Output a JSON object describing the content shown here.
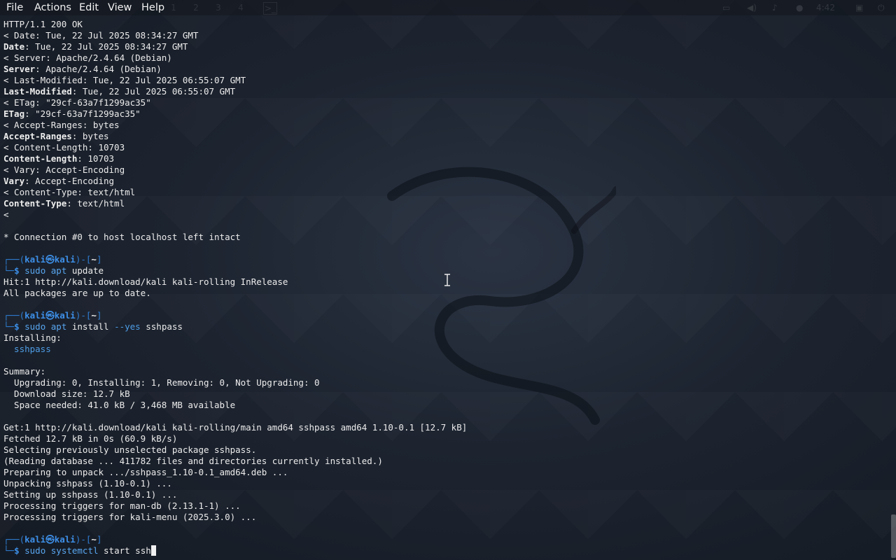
{
  "menubar": {
    "items": [
      "File",
      "Actions",
      "Edit",
      "View",
      "Help"
    ],
    "workspaces": [
      "1",
      "2",
      "3",
      "4"
    ],
    "clock": "4:42"
  },
  "colors": {
    "background": "#1d2430",
    "prompt_frame": "#2f7fd6",
    "prompt_user": "#3d8fe8",
    "command": "#58a6f0",
    "text": "#ececec"
  },
  "icons": [
    "terminal-icon",
    "display-icon",
    "volume-icon",
    "bell-icon",
    "network-icon",
    "lock-icon",
    "power-icon"
  ],
  "terminal": {
    "lines": [
      {
        "type": "plain",
        "text": "HTTP/1.1 200 OK"
      },
      {
        "type": "plain",
        "text": "< Date: Tue, 22 Jul 2025 08:34:27 GMT"
      },
      {
        "type": "header",
        "key": "Date",
        "value": ": Tue, 22 Jul 2025 08:34:27 GMT"
      },
      {
        "type": "plain",
        "text": "< Server: Apache/2.4.64 (Debian)"
      },
      {
        "type": "header",
        "key": "Server",
        "value": ": Apache/2.4.64 (Debian)"
      },
      {
        "type": "plain",
        "text": "< Last-Modified: Tue, 22 Jul 2025 06:55:07 GMT"
      },
      {
        "type": "header",
        "key": "Last-Modified",
        "value": ": Tue, 22 Jul 2025 06:55:07 GMT"
      },
      {
        "type": "plain",
        "text": "< ETag: \"29cf-63a7f1299ac35\""
      },
      {
        "type": "header",
        "key": "ETag",
        "value": ": \"29cf-63a7f1299ac35\""
      },
      {
        "type": "plain",
        "text": "< Accept-Ranges: bytes"
      },
      {
        "type": "header",
        "key": "Accept-Ranges",
        "value": ": bytes"
      },
      {
        "type": "plain",
        "text": "< Content-Length: 10703"
      },
      {
        "type": "header",
        "key": "Content-Length",
        "value": ": 10703"
      },
      {
        "type": "plain",
        "text": "< Vary: Accept-Encoding"
      },
      {
        "type": "header",
        "key": "Vary",
        "value": ": Accept-Encoding"
      },
      {
        "type": "plain",
        "text": "< Content-Type: text/html"
      },
      {
        "type": "header",
        "key": "Content-Type",
        "value": ": text/html"
      },
      {
        "type": "plain",
        "text": "<"
      },
      {
        "type": "plain",
        "text": ""
      },
      {
        "type": "plain",
        "text": "* Connection #0 to host localhost left intact"
      },
      {
        "type": "plain",
        "text": ""
      },
      {
        "type": "prompt1"
      },
      {
        "type": "prompt2",
        "parts": [
          {
            "t": "sudo",
            "c": "cmd"
          },
          {
            "t": " "
          },
          {
            "t": "apt",
            "c": "cmd"
          },
          {
            "t": " update"
          }
        ]
      },
      {
        "type": "plain",
        "text": "Hit:1 http://kali.download/kali kali-rolling InRelease"
      },
      {
        "type": "plain",
        "text": "All packages are up to date."
      },
      {
        "type": "plain",
        "text": ""
      },
      {
        "type": "prompt1"
      },
      {
        "type": "prompt2",
        "parts": [
          {
            "t": "sudo",
            "c": "cmd"
          },
          {
            "t": " "
          },
          {
            "t": "apt",
            "c": "cmd"
          },
          {
            "t": " install "
          },
          {
            "t": "--yes",
            "c": "opt"
          },
          {
            "t": " sshpass"
          }
        ]
      },
      {
        "type": "plain",
        "text": "Installing:"
      },
      {
        "type": "pkg",
        "text": "  sshpass"
      },
      {
        "type": "plain",
        "text": ""
      },
      {
        "type": "plain",
        "text": "Summary:"
      },
      {
        "type": "plain",
        "text": "  Upgrading: 0, Installing: 1, Removing: 0, Not Upgrading: 0"
      },
      {
        "type": "plain",
        "text": "  Download size: 12.7 kB"
      },
      {
        "type": "plain",
        "text": "  Space needed: 41.0 kB / 3,468 MB available"
      },
      {
        "type": "plain",
        "text": ""
      },
      {
        "type": "plain",
        "text": "Get:1 http://kali.download/kali kali-rolling/main amd64 sshpass amd64 1.10-0.1 [12.7 kB]"
      },
      {
        "type": "plain",
        "text": "Fetched 12.7 kB in 0s (60.9 kB/s)"
      },
      {
        "type": "plain",
        "text": "Selecting previously unselected package sshpass."
      },
      {
        "type": "plain",
        "text": "(Reading database ... 411782 files and directories currently installed.)"
      },
      {
        "type": "plain",
        "text": "Preparing to unpack .../sshpass_1.10-0.1_amd64.deb ..."
      },
      {
        "type": "plain",
        "text": "Unpacking sshpass (1.10-0.1) ..."
      },
      {
        "type": "plain",
        "text": "Setting up sshpass (1.10-0.1) ..."
      },
      {
        "type": "plain",
        "text": "Processing triggers for man-db (2.13.1-1) ..."
      },
      {
        "type": "plain",
        "text": "Processing triggers for kali-menu (2025.3.0) ..."
      },
      {
        "type": "plain",
        "text": ""
      },
      {
        "type": "prompt1"
      },
      {
        "type": "prompt2",
        "parts": [
          {
            "t": "sudo",
            "c": "cmd"
          },
          {
            "t": " "
          },
          {
            "t": "systemctl",
            "c": "cmd"
          },
          {
            "t": " start ssh"
          }
        ],
        "cursor": true
      }
    ],
    "prompt": {
      "top_left": "┌──(",
      "user": "kali",
      "at": "㉿",
      "host": "kali",
      "close": ")-[",
      "dir": "~",
      "end": "]",
      "bottom": "└─",
      "dollar": "$ "
    }
  }
}
